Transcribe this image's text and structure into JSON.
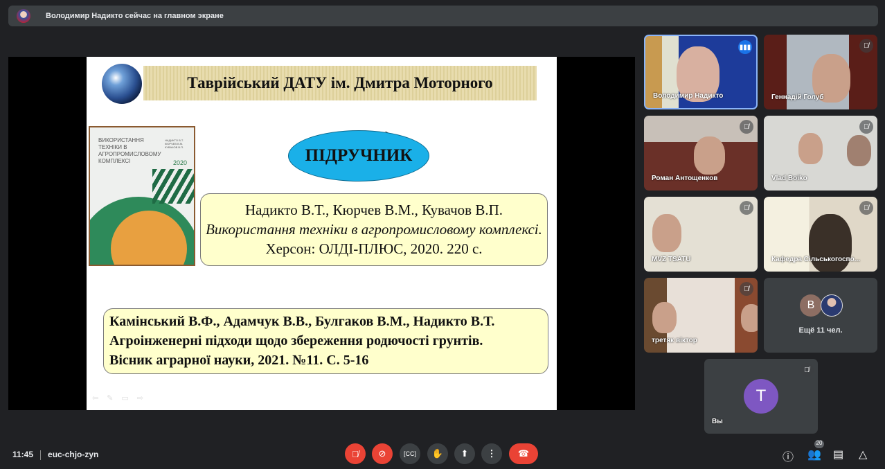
{
  "banner": {
    "text": "Володимир Надикто сейчас на главном экране"
  },
  "slide": {
    "header": "Таврійський ДАТУ ім. Дмитра Моторного",
    "book_cover": {
      "title": "ВИКОРИСТАННЯ ТЕХНІКИ В АГРОПРОМИСЛОВОМУ КОМПЛЕКСІ",
      "authors": "НАДИКТО В.Т. КЮРЧЕВ В.М. КУВАЧОВ В.П.",
      "year": "2020"
    },
    "label": "ПІДРУЧНИК",
    "ref1": {
      "authors": "Надикто В.Т., Кюрчев В.М., Кувачов В.П.",
      "title": "Використання техніки в агропромисловому комплексі.",
      "rest": " Херсон:  ОЛДІ-ПЛЮС, 2020. 220 с."
    },
    "ref2": {
      "line1": "Камінський В.Ф., Адамчук В.В., Булгаков В.М., Надикто В.Т.",
      "line2": "Агроінженерні підходи щодо збереження родючості грунтів.",
      "line3": "Вісник аграрної науки, 2021. №11. С. 5-16"
    }
  },
  "participants": [
    {
      "name": "Володимир Надикто"
    },
    {
      "name": "Геннадій Голуб"
    },
    {
      "name": "Роман Антощенков"
    },
    {
      "name": "Vlad Boiko"
    },
    {
      "name": "MVZ TSATU"
    },
    {
      "name": "Кафедра Сільськогоспо..."
    },
    {
      "name": "третяк віктор"
    }
  ],
  "others": {
    "initial": "В",
    "label": "Ещё 11 чел."
  },
  "self": {
    "initial": "Т",
    "name": "Вы",
    "avatar_color": "#7e57c2"
  },
  "bottom": {
    "time": "11:45",
    "meeting_code": "euc-chjo-zyn",
    "participant_count": "20"
  }
}
